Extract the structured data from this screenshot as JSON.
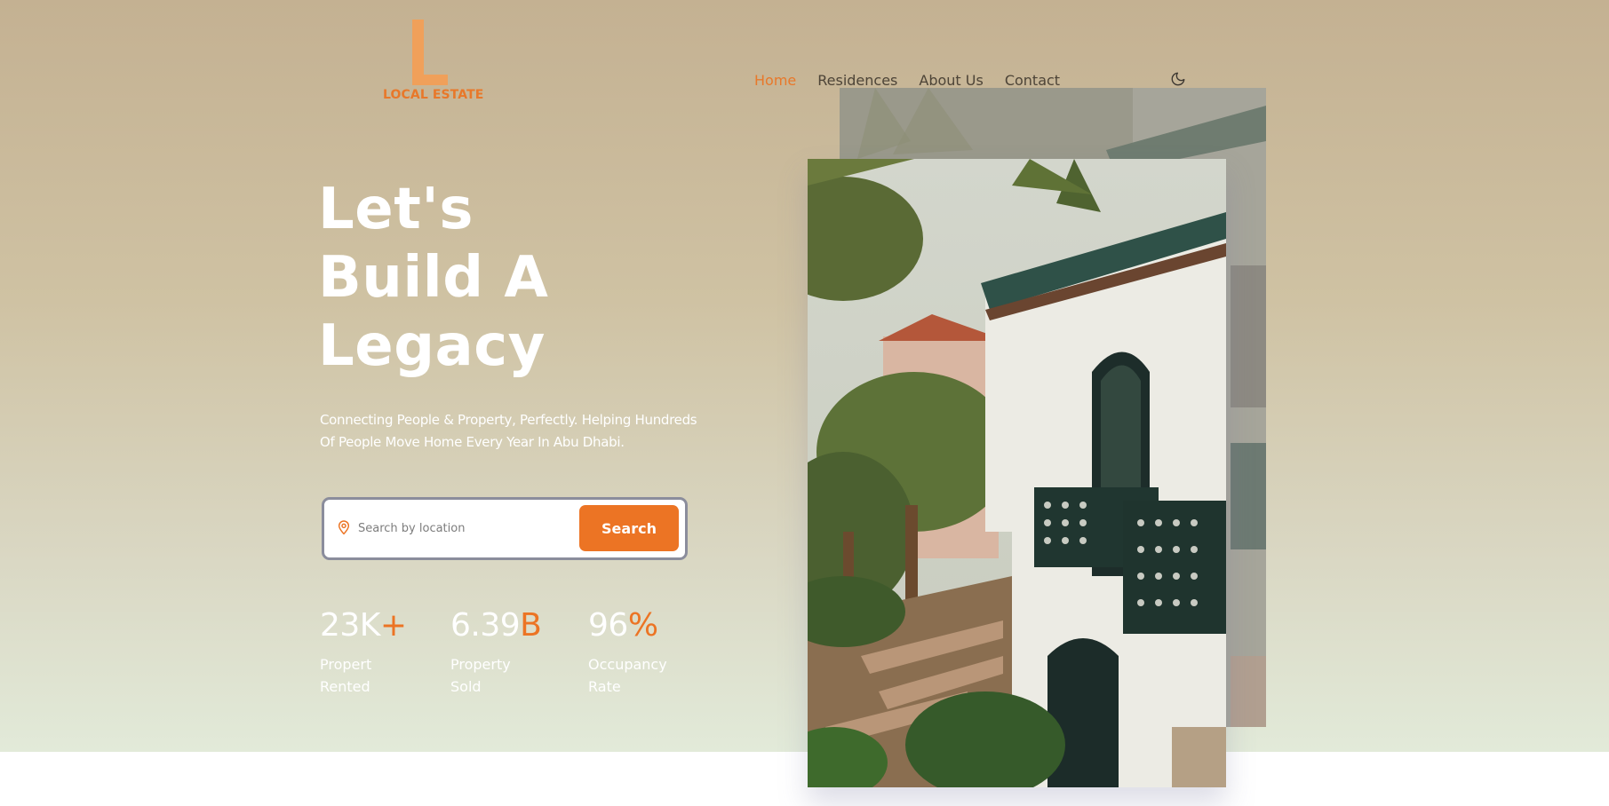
{
  "brand": {
    "logo_letter": "L",
    "name": "LOCAL ESTATE",
    "accent_color": "#ec7424"
  },
  "nav": {
    "items": [
      {
        "label": "Home",
        "active": true
      },
      {
        "label": "Residences",
        "active": false
      },
      {
        "label": "About Us",
        "active": false
      },
      {
        "label": "Contact",
        "active": false
      }
    ],
    "theme_toggle_icon": "moon-icon"
  },
  "hero": {
    "headline": [
      "Let's",
      "Build A",
      "Legacy"
    ],
    "subtext": [
      "Connecting People & Property, Perfectly. Helping Hundreds",
      "Of People Move Home Every Year In Abu Dhabi."
    ]
  },
  "search": {
    "icon": "location-pin-icon",
    "placeholder": "Search by location",
    "value": "",
    "button_label": "Search"
  },
  "stats": [
    {
      "value": "23K",
      "suffix": "+",
      "label": [
        "Propert",
        "Rented"
      ]
    },
    {
      "value": "6.39",
      "suffix": "B",
      "label": [
        "Property",
        "Sold"
      ]
    },
    {
      "value": "96",
      "suffix": "%",
      "label": [
        "Occupancy",
        "Rate"
      ]
    }
  ],
  "images": {
    "back": "villa-photo-background",
    "front": "villa-photo-main"
  }
}
